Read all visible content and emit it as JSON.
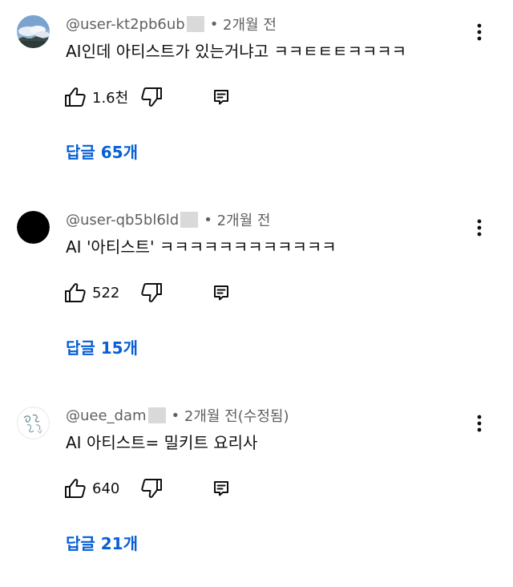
{
  "comments": [
    {
      "handle": "@user-kt2pb6ub",
      "time": "2개월 전",
      "text": "AI인데 아티스트가 있는거냐고 ㅋㅋㅌㅌㅌㅋㅋㅋㅋ",
      "likes": "1.6천",
      "replies": "답글 65개",
      "avatar": "sky-photo-avatar"
    },
    {
      "handle": "@user-qb5bl6ld",
      "time": "2개월 전",
      "text": "AI '아티스트' ㅋㅋㅋㅋㅋㅋㅋㅋㅋㅋㅋㅋ",
      "likes": "522",
      "replies": "답글 15개",
      "avatar": "black-circle-avatar"
    },
    {
      "handle": "@uee_dam",
      "time": "2개월 전(수정됨)",
      "text": "AI 아티스트= 밀키트 요리사",
      "likes": "640",
      "replies": "답글 21개",
      "avatar": "sketch-avatar"
    }
  ],
  "colors": {
    "reply_link": "#065fd4",
    "meta_text": "#606060",
    "body_text": "#0f0f0f"
  },
  "icons": [
    "more-vert-icon",
    "thumb-up-icon",
    "thumb-down-icon",
    "reply-icon"
  ]
}
